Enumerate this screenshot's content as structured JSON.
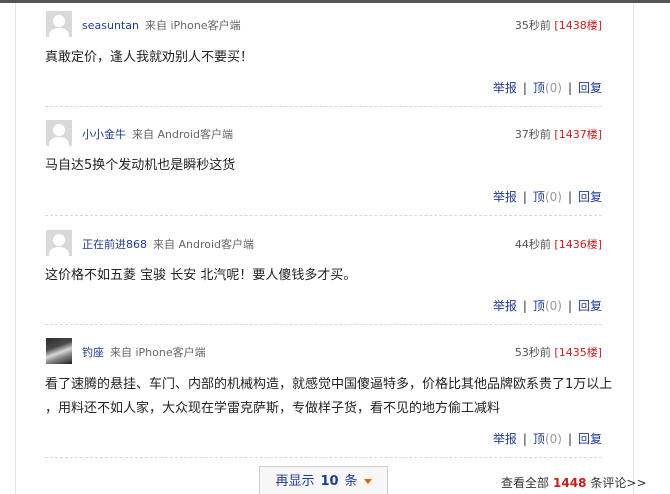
{
  "comments": [
    {
      "username": "seasuntan",
      "source": "来自 iPhone客户端",
      "time": "35秒前",
      "floor": "[1438楼]",
      "text": [
        "真敢定价，逢人我就劝别人不要买！"
      ],
      "avatar": "default-avatar-icon"
    },
    {
      "username": "小小金牛",
      "source": "来自 Android客户端",
      "time": "37秒前",
      "floor": "[1437楼]",
      "text": [
        "马自达5换个发动机也是瞬秒这货"
      ],
      "avatar": "default-avatar-icon"
    },
    {
      "username": "正在前进868",
      "source": "来自 Android客户端",
      "time": "44秒前",
      "floor": "[1436楼]",
      "text": [
        "这价格不如五菱 宝骏 长安 北汽呢！要人傻钱多才买。"
      ],
      "avatar": "default-avatar-icon"
    },
    {
      "username": "钓座",
      "source": "来自 iPhone客户端",
      "time": "53秒前",
      "floor": "[1435楼]",
      "text": [
        "看了速腾的悬挂、车门、内部的机械构造，就感觉中国傻逼特多，价格比其他品牌欧系贵了1万以上",
        "，用料还不如人家，大众现在学雷克萨斯，专做样子货，看不见的地方偷工减料"
      ],
      "avatar": "photo-avatar"
    }
  ],
  "actions": {
    "report": "举报",
    "up": "顶",
    "up_count": "(0)",
    "reply": "回复",
    "separator": "|"
  },
  "footer": {
    "more_prefix": "再显示",
    "more_count": "10",
    "more_suffix": "条",
    "viewall_prefix": "查看全部",
    "total": "1448",
    "viewall_suffix": "条评论>>"
  },
  "colors": {
    "link": "#1f3a93",
    "floor": "#c81e1e",
    "caret": "#e85a00"
  }
}
